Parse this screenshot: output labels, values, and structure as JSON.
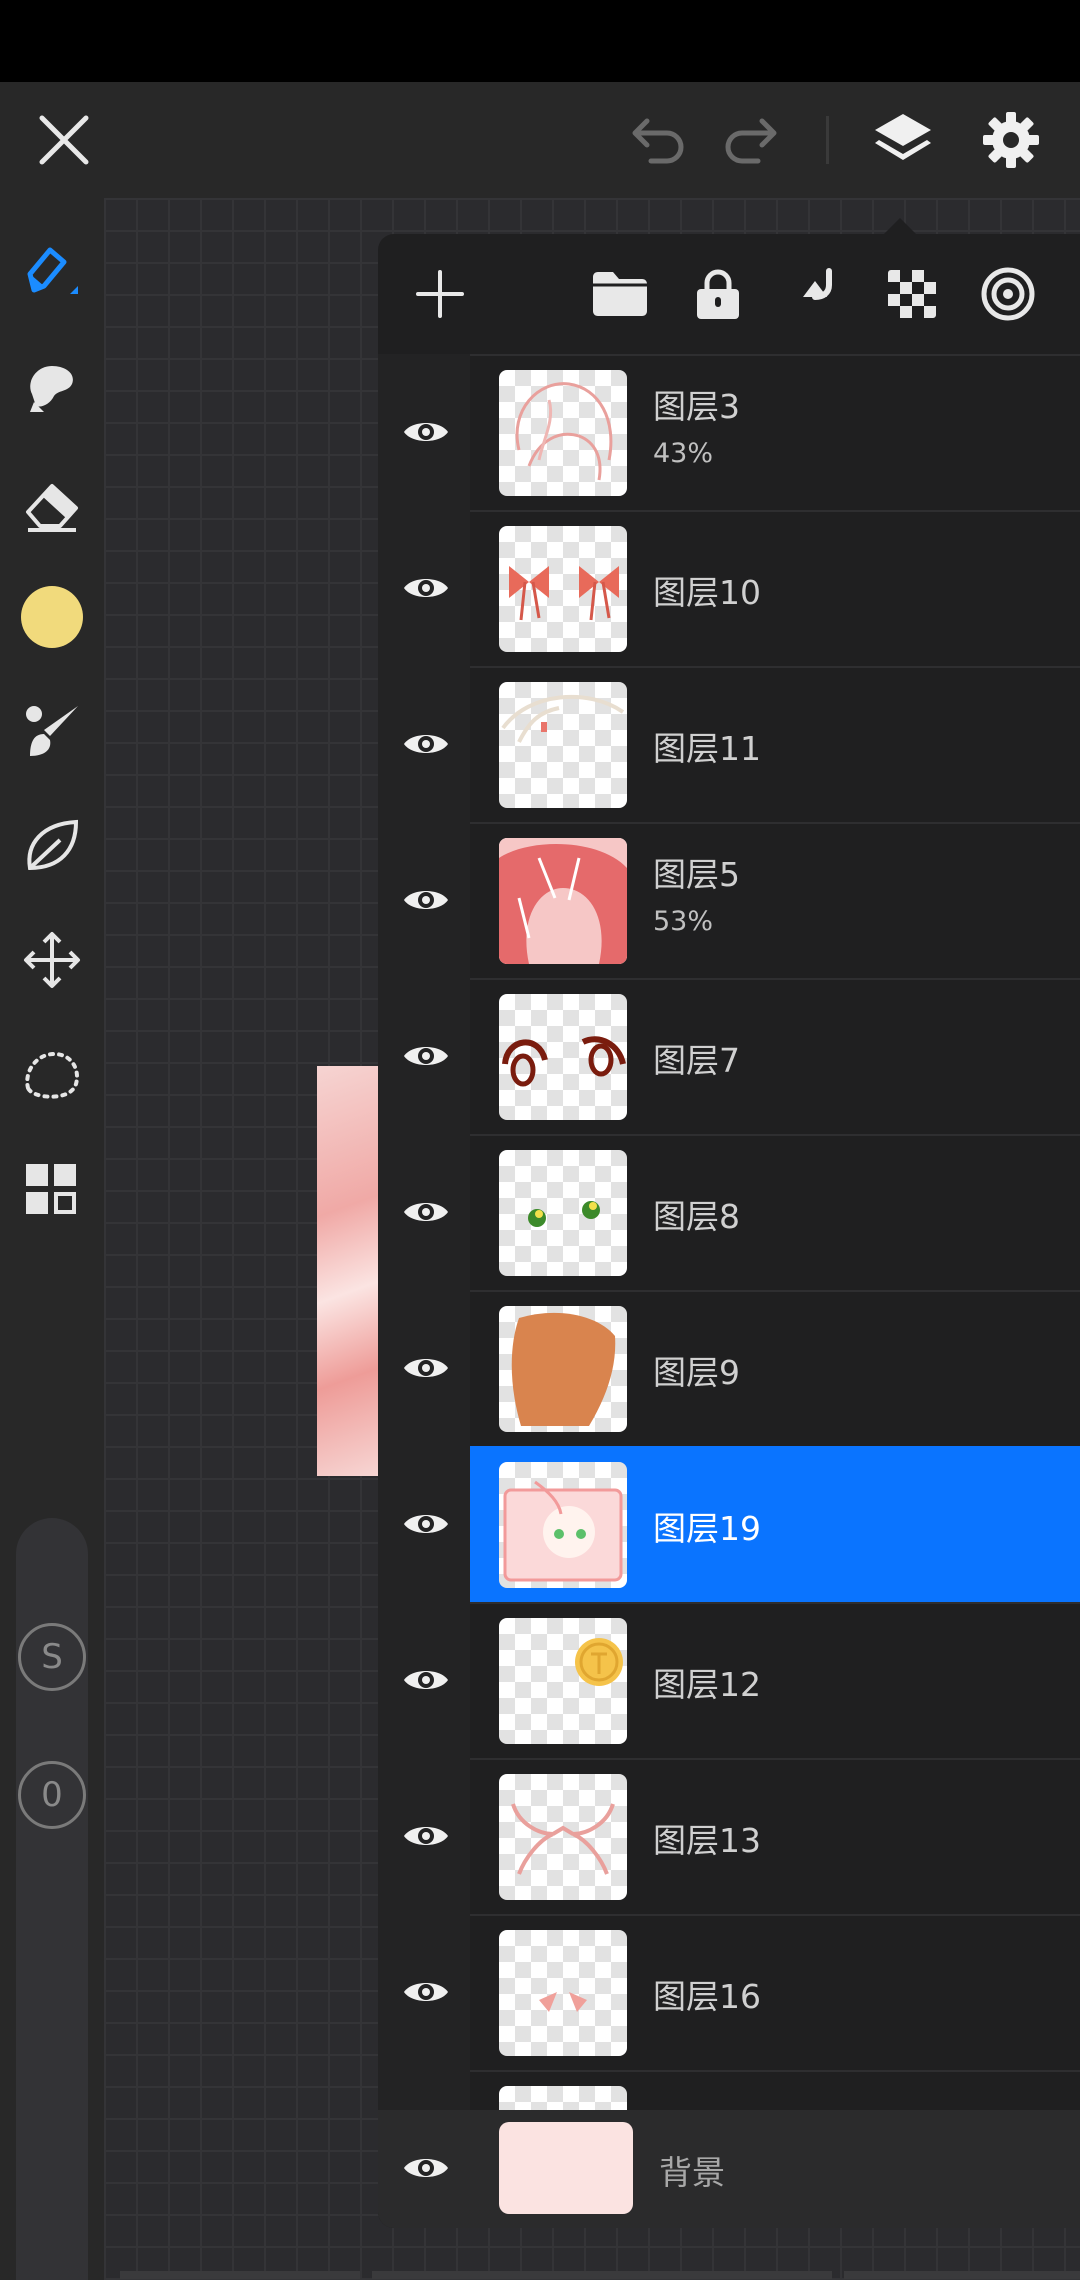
{
  "colors": {
    "accent": "#0a74ff",
    "primary_color": "#f1da7c",
    "background_layer_color": "#fbe3e1"
  },
  "top_bar": {
    "icons": [
      "close-icon",
      "undo-icon",
      "redo-icon",
      "layers-icon",
      "settings-icon"
    ]
  },
  "left_toolbar": {
    "tools": [
      "pen-tool",
      "smudge-tool",
      "eraser-tool",
      "color-swatch",
      "brush-tool",
      "leaf-tool",
      "move-tool",
      "lasso-tool",
      "grid-tool"
    ],
    "size_badge": "S",
    "opacity_badge": "0"
  },
  "layers_panel": {
    "toolbar_icons": [
      "add-icon",
      "folder-icon",
      "lock-icon",
      "merge-down-icon",
      "transparency-icon",
      "target-icon"
    ],
    "layers": [
      {
        "name": "图层3",
        "opacity": "43%"
      },
      {
        "name": "图层10",
        "opacity": ""
      },
      {
        "name": "图层11",
        "opacity": ""
      },
      {
        "name": "图层5",
        "opacity": "53%"
      },
      {
        "name": "图层7",
        "opacity": ""
      },
      {
        "name": "图层8",
        "opacity": ""
      },
      {
        "name": "图层9",
        "opacity": ""
      },
      {
        "name": "图层19",
        "opacity": "",
        "selected": true
      },
      {
        "name": "图层12",
        "opacity": ""
      },
      {
        "name": "图层13",
        "opacity": ""
      },
      {
        "name": "图层16",
        "opacity": ""
      }
    ],
    "background_layer": {
      "name": "背景"
    }
  }
}
